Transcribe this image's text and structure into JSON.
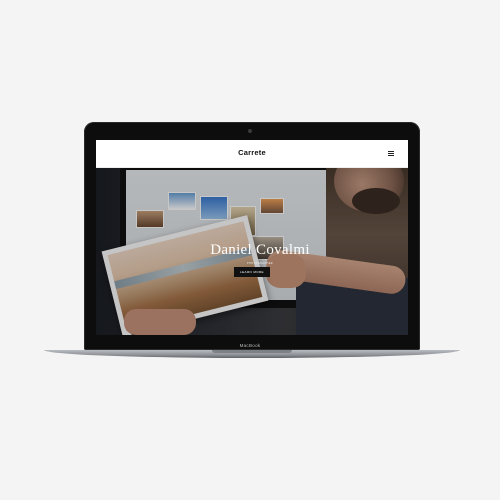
{
  "device": {
    "label": "MacBook"
  },
  "site": {
    "logo": "Carrete",
    "menu_icon": "hamburger-icon"
  },
  "hero": {
    "title": "Daniel Covalmi",
    "subtitle": "PHOTOGRAPHER",
    "button_label": "LEARN MORE"
  }
}
